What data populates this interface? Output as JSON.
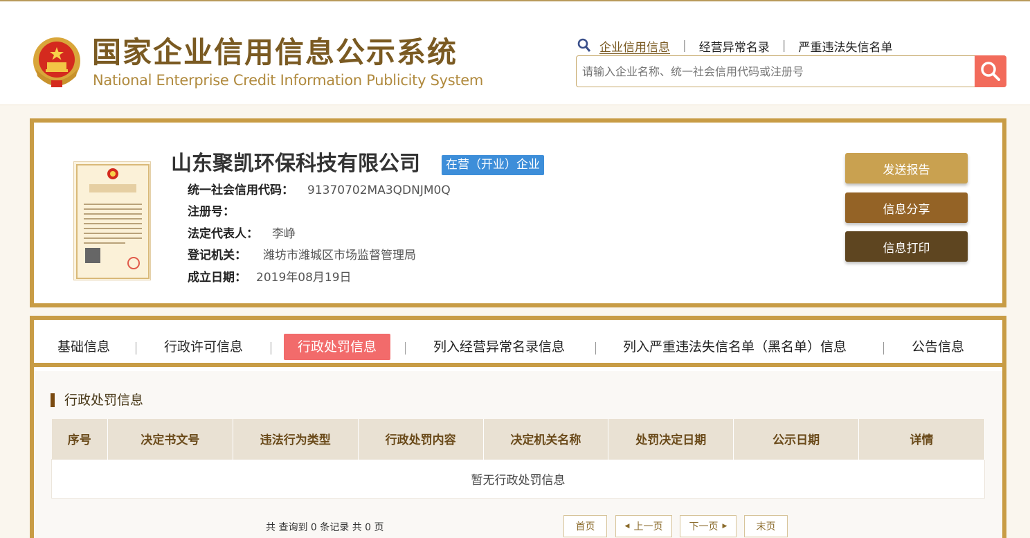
{
  "header": {
    "title_cn": "国家企业信用信息公示系统",
    "title_en": "National Enterprise Credit Information Publicity System",
    "emblem_icon": "national-emblem-icon",
    "search_tabs": [
      "企业信用信息",
      "经营异常名录",
      "严重违法失信名单"
    ],
    "search_placeholder": "请输入企业名称、统一社会信用代码或注册号"
  },
  "company": {
    "name": "山东聚凯环保科技有限公司",
    "status": "在营（开业）企业",
    "fields": [
      {
        "label": "统一社会信用代码：",
        "value": "91370702MA3QDNJM0Q"
      },
      {
        "label": "注册号：",
        "value": ""
      },
      {
        "label": "法定代表人：",
        "value": "李峥"
      },
      {
        "label": "登记机关：",
        "value": "潍坊市潍城区市场监督管理局"
      },
      {
        "label": "成立日期：",
        "value": "2019年08月19日"
      }
    ],
    "license_image_title": "营业执照",
    "actions": [
      "发送报告",
      "信息分享",
      "信息打印"
    ]
  },
  "tabs": [
    "基础信息",
    "行政许可信息",
    "行政处罚信息",
    "列入经营异常名录信息",
    "列入严重违法失信名单（黑名单）信息",
    "公告信息"
  ],
  "active_tab": "行政处罚信息",
  "section": {
    "title": "行政处罚信息",
    "columns": [
      "序号",
      "决定书文号",
      "违法行为类型",
      "行政处罚内容",
      "决定机关名称",
      "处罚决定日期",
      "公示日期",
      "详情"
    ],
    "empty_text": "暂无行政处罚信息"
  },
  "pagination": {
    "summary": "共 查询到 0 条记录 共 0 页",
    "first": "首页",
    "prev": "上一页",
    "next": "下一页",
    "last": "末页"
  },
  "colors": {
    "gold_border": "#c89c45",
    "active_tab": "#f26b6b",
    "status_badge": "#3d8ed9",
    "btn_send": "#c9a150",
    "btn_share": "#946326",
    "btn_print": "#5e4520"
  }
}
